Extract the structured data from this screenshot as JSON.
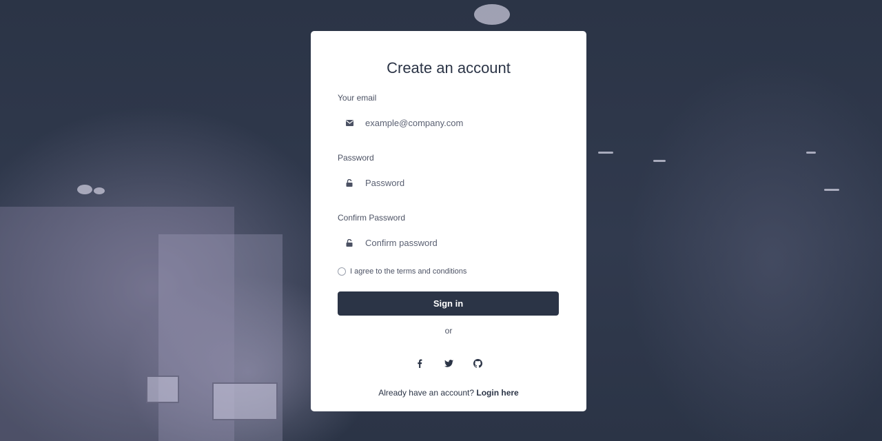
{
  "form": {
    "title": "Create an account",
    "email": {
      "label": "Your email",
      "placeholder": "example@company.com",
      "icon": "envelope-icon"
    },
    "password": {
      "label": "Password",
      "placeholder": "Password",
      "icon": "unlock-icon"
    },
    "confirm": {
      "label": "Confirm Password",
      "placeholder": "Confirm password",
      "icon": "unlock-icon"
    },
    "terms_label": "I agree to the terms and conditions",
    "submit_label": "Sign in",
    "divider_text": "or",
    "social": [
      "facebook-icon",
      "twitter-icon",
      "github-icon"
    ],
    "footer_text": "Already have an account?",
    "footer_link": "Login here"
  },
  "colors": {
    "primary": "#2b3446",
    "background": "#2b3446",
    "card": "#ffffff"
  }
}
